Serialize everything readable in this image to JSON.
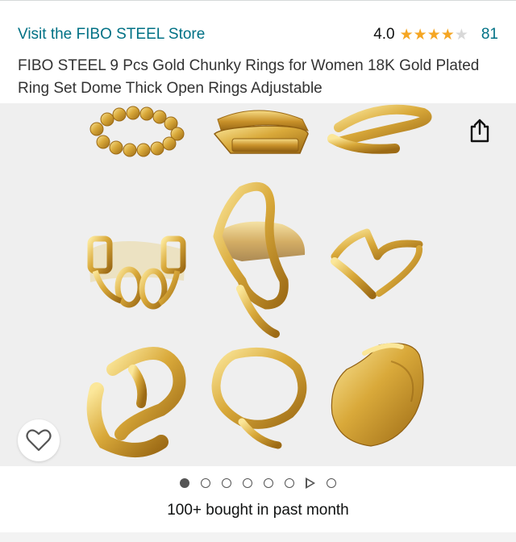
{
  "header": {
    "store_link": "Visit the FIBO STEEL Store",
    "rating_value": "4.0",
    "rating_stars": 4.0,
    "rating_count": "81"
  },
  "product": {
    "title": "FIBO STEEL 9 Pcs Gold Chunky Rings for Women 18K Gold Plated Ring Set Dome Thick Open Rings Adjustable"
  },
  "gallery": {
    "image_alt": "Nine gold rings arranged in a 3x3 grid",
    "share_icon": "share-icon",
    "favorite_icon": "heart-icon",
    "dot_count": 7,
    "active_index": 0,
    "has_video": true,
    "colors": {
      "gold": "#d9a93a",
      "gold_dark": "#a8741b",
      "gold_light": "#f7e08a",
      "background": "#efefef"
    }
  },
  "social_proof": {
    "bought_text": "100+ bought in past month"
  }
}
